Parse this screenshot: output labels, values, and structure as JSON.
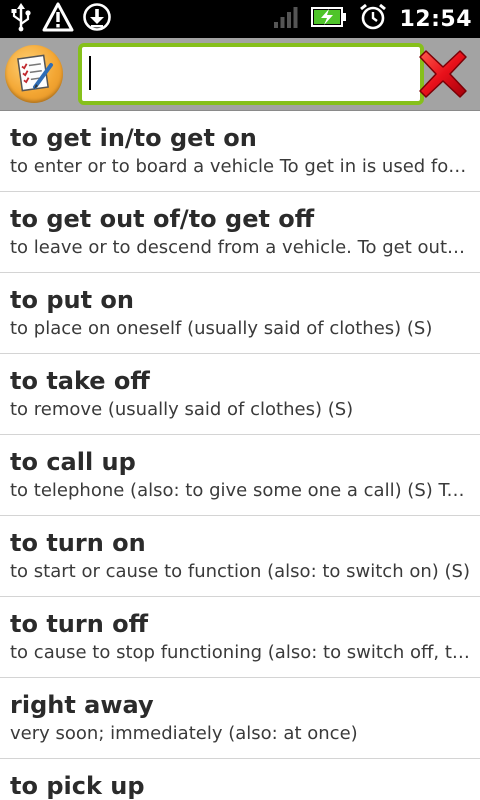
{
  "status_bar": {
    "time": "12:54",
    "icons": [
      "usb-icon",
      "warning-icon",
      "download-icon",
      "signal-icon",
      "battery-charging-icon",
      "alarm-icon"
    ]
  },
  "toolbar": {
    "app_icon": "notepad-checklist-icon",
    "search_value": "",
    "search_placeholder": "",
    "clear_icon": "red-x-icon"
  },
  "colors": {
    "toolbar_bg": "#a3a3a3",
    "input_border": "#86c01b",
    "app_icon_orange": "#f3a633",
    "clear_red": "#e8101a"
  },
  "entries": [
    {
      "title": "to get in/to get on",
      "desc": "to enter or to board a vehicle To get in is used for cars; to get on is used for buses, trains"
    },
    {
      "title": "to get out of/to get off",
      "desc": "to leave or to descend from a vehicle. To get out of is used for cars; to get off is used for buses"
    },
    {
      "title": "to put on",
      "desc": "to place on oneself (usually said of clothes) (S)"
    },
    {
      "title": "to take off",
      "desc": "to remove (usually said of clothes) (S)"
    },
    {
      "title": "to call up",
      "desc": "to telephone (also: to give some one a call) (S) To call is also commonly used"
    },
    {
      "title": "to turn on",
      "desc": "to start or cause to function (also: to switch on) (S)"
    },
    {
      "title": "to turn off",
      "desc": "to cause to stop functioning (also: to switch off, to shut off) (S)"
    },
    {
      "title": "right away",
      "desc": "very soon; immediately (also: at once)"
    },
    {
      "title": "to pick up",
      "desc": ""
    }
  ]
}
